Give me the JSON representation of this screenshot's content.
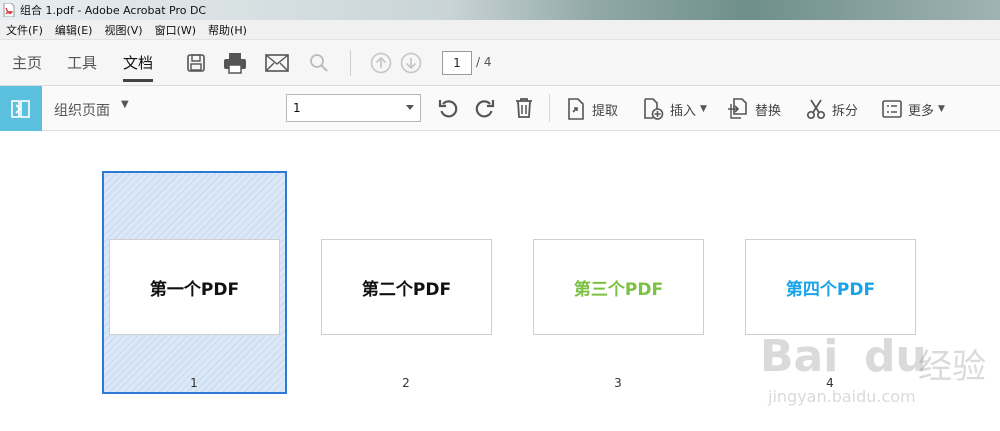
{
  "window": {
    "title": "组合 1.pdf - Adobe Acrobat Pro DC"
  },
  "menu": [
    "文件(F)",
    "编辑(E)",
    "视图(V)",
    "窗口(W)",
    "帮助(H)"
  ],
  "toolbar": {
    "tabs": [
      "主页",
      "工具",
      "文档"
    ],
    "active_tab": "文档",
    "current_page": "1",
    "total_pages": "/ 4"
  },
  "organize": {
    "title": "组织页面",
    "page_selector": "1",
    "actions": {
      "extract": "提取",
      "insert": "插入",
      "replace": "替换",
      "split": "拆分",
      "more": "更多"
    }
  },
  "thumbnails": [
    {
      "number": "1",
      "text": "第一个PDF",
      "color": "#111111",
      "selected": true
    },
    {
      "number": "2",
      "text": "第二个PDF",
      "color": "#111111",
      "selected": false
    },
    {
      "number": "3",
      "text": "第三个PDF",
      "color": "#7cc242",
      "selected": false
    },
    {
      "number": "4",
      "text": "第四个PDF",
      "color": "#1aa3e8",
      "selected": false
    }
  ],
  "watermark": {
    "brand": "Bai",
    "brand_suffix": "du",
    "product": "经验",
    "domain": "jingyan.baidu.com"
  },
  "colors": {
    "accent": "#5bc0de",
    "selection_border": "#2e7bd6",
    "selection_fill": "#dce8f7"
  }
}
